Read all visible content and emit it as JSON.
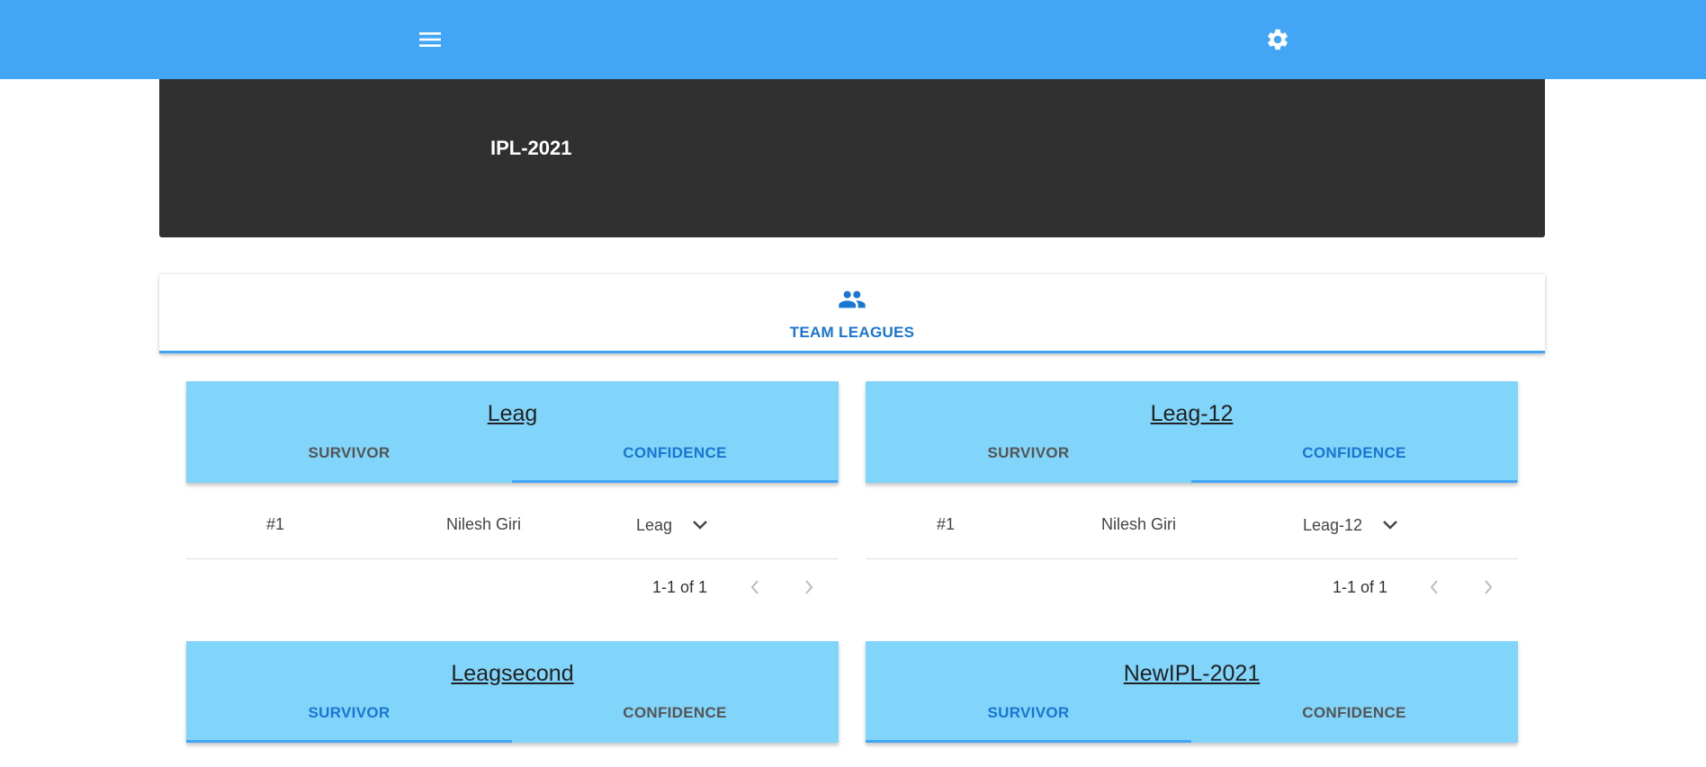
{
  "header": {
    "menu_icon": "menu-icon",
    "settings_icon": "gear-icon",
    "color": "#42a5f5"
  },
  "banner": {
    "title": "IPL-2021"
  },
  "league_tabs": {
    "tab": {
      "label": "TEAM LEAGUES",
      "icon": "group-icon"
    }
  },
  "leagues": [
    {
      "name": "Leag",
      "tabs": [
        "SURVIVOR",
        "CONFIDENCE"
      ],
      "active_tab": "CONFIDENCE",
      "row": {
        "rank": "#1",
        "player": "Nilesh Giri",
        "selected": "Leag"
      },
      "pagination": "1-1 of 1"
    },
    {
      "name": "Leag-12",
      "tabs": [
        "SURVIVOR",
        "CONFIDENCE"
      ],
      "active_tab": "CONFIDENCE",
      "row": {
        "rank": "#1",
        "player": "Nilesh Giri",
        "selected": "Leag-12"
      },
      "pagination": "1-1 of 1"
    },
    {
      "name": "Leagsecond",
      "tabs": [
        "SURVIVOR",
        "CONFIDENCE"
      ],
      "active_tab": "SURVIVOR"
    },
    {
      "name": "NewIPL-2021",
      "tabs": [
        "SURVIVOR",
        "CONFIDENCE"
      ],
      "active_tab": "SURVIVOR"
    }
  ]
}
